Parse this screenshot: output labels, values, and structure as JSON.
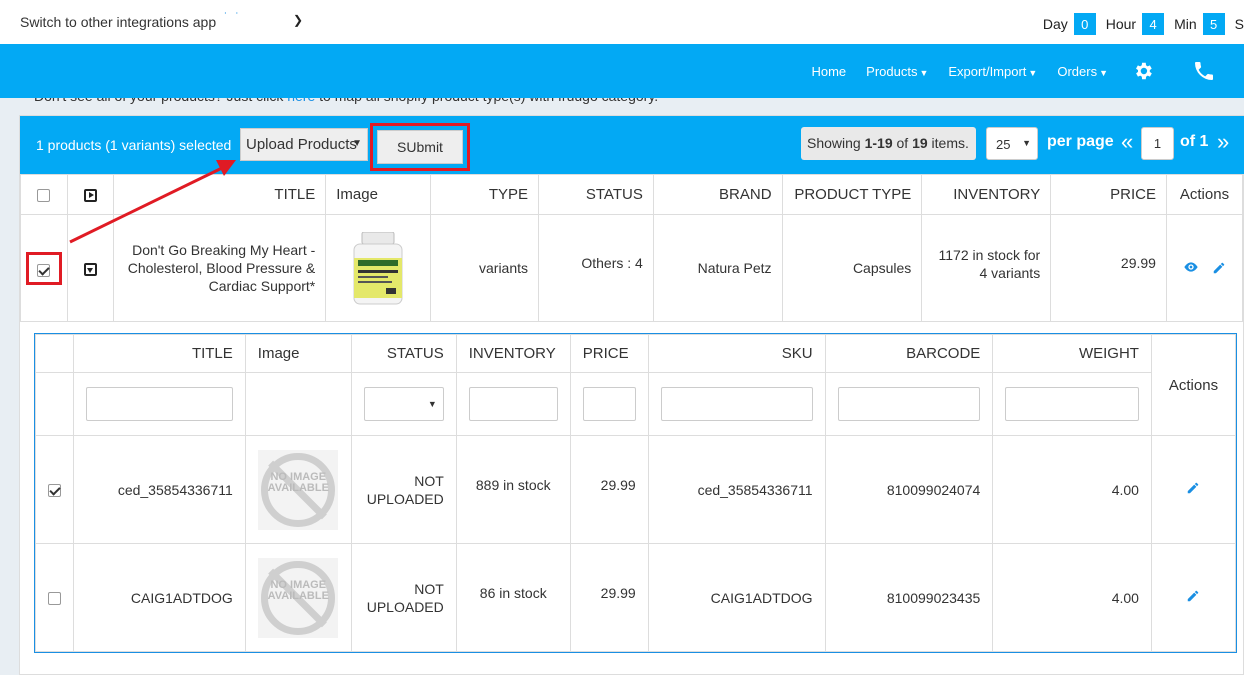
{
  "topbar": {
    "switch_label": "Switch to other integrations app",
    "timer": [
      {
        "label": "Day",
        "value": "0"
      },
      {
        "label": "Hour",
        "value": "4"
      },
      {
        "label": "Min",
        "value": "5"
      },
      {
        "label": "S",
        "value": ""
      }
    ]
  },
  "nav": {
    "home": "Home",
    "products": "Products",
    "export_import": "Export/Import",
    "orders": "Orders",
    "settings_icon": "gear-icon",
    "phone_icon": "phone-icon"
  },
  "notice": {
    "prefix": "Don't see all of your products? Just click ",
    "link": "here",
    "suffix": " to map all shopify product type(s) with fruugo category."
  },
  "toolbar": {
    "selected_text": "1 products (1 variants) selected",
    "action_select": "Upload Products",
    "submit_label": "SUbmit",
    "showing_prefix": "Showing ",
    "showing_range": "1-19",
    "showing_of": " of ",
    "showing_total": "19",
    "showing_suffix": " items.",
    "per_page_value": "25",
    "per_page_label": "per page",
    "page_prev": "«",
    "current_page": "1",
    "page_of": "of 1",
    "page_next": "»"
  },
  "colors": {
    "accent": "#03a9f4",
    "highlight": "#e01b24",
    "link": "#1a8fe3"
  },
  "main_table": {
    "headers": {
      "title": "TITLE",
      "image": "Image",
      "type": "TYPE",
      "status": "STATUS",
      "brand": "BRAND",
      "product_type": "PRODUCT TYPE",
      "inventory": "INVENTORY",
      "price": "PRICE",
      "actions": "Actions"
    },
    "row": {
      "checked": true,
      "title": "Don't Go Breaking My Heart - Cholesterol, Blood Pressure & Cardiac Support*",
      "image_label": "NATURA PETZ",
      "type": "variants",
      "status": "Others : 4",
      "brand": "Natura Petz",
      "product_type": "Capsules",
      "inventory": "1172 in stock for 4 variants",
      "price": "29.99"
    }
  },
  "variant_table": {
    "headers": {
      "title": "TITLE",
      "image": "Image",
      "status": "STATUS",
      "inventory": "INVENTORY",
      "price": "PRICE",
      "sku": "SKU",
      "barcode": "BARCODE",
      "weight": "WEIGHT",
      "actions": "Actions"
    },
    "no_image_text": "NO IMAGE AVAILABLE",
    "rows": [
      {
        "checked": true,
        "title": "ced_35854336711",
        "status": "NOT UPLOADED",
        "inventory": "889 in stock",
        "price": "29.99",
        "sku": "ced_35854336711",
        "barcode": "810099024074",
        "weight": "4.00"
      },
      {
        "checked": false,
        "title": "CAIG1ADTDOG",
        "status": "NOT UPLOADED",
        "inventory": "86 in stock",
        "price": "29.99",
        "sku": "CAIG1ADTDOG",
        "barcode": "810099023435",
        "weight": "4.00"
      }
    ]
  }
}
